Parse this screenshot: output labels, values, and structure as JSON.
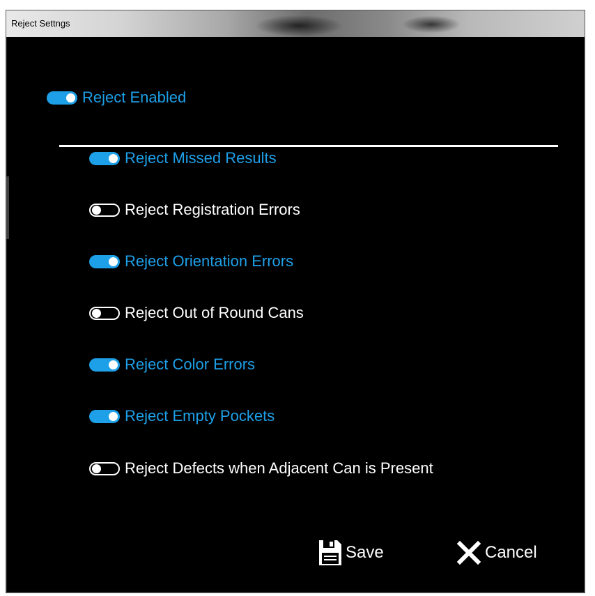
{
  "window": {
    "title": "Reject Settngs"
  },
  "master": {
    "label": "Reject Enabled",
    "enabled": true
  },
  "options": [
    {
      "label": "Reject Missed Results",
      "enabled": true
    },
    {
      "label": "Reject Registration Errors",
      "enabled": false
    },
    {
      "label": "Reject Orientation Errors",
      "enabled": true
    },
    {
      "label": "Reject Out of Round Cans",
      "enabled": false
    },
    {
      "label": "Reject Color Errors",
      "enabled": true
    },
    {
      "label": "Reject Empty Pockets",
      "enabled": true
    },
    {
      "label": "Reject Defects when Adjacent Can is Present",
      "enabled": false
    }
  ],
  "actions": {
    "save": {
      "label": "Save",
      "icon": "floppy-disk-icon"
    },
    "cancel": {
      "label": "Cancel",
      "icon": "close-x-icon"
    }
  },
  "colors": {
    "accent": "#1ea0e8",
    "background": "#000000",
    "text": "#ffffff"
  }
}
